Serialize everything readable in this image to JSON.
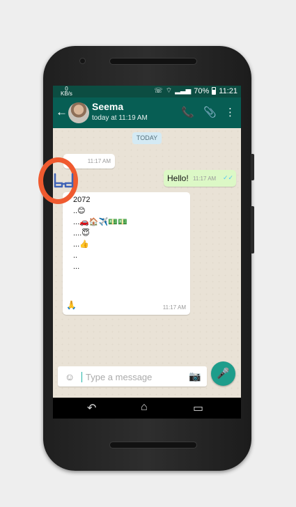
{
  "status_bar": {
    "speed": "0",
    "speed_unit": "KB/s",
    "battery": "70%",
    "time": "11:21"
  },
  "chat_header": {
    "name": "Seema",
    "status": "today at 11:19 AM"
  },
  "date_chip": "TODAY",
  "messages": [
    {
      "direction": "in",
      "text": "",
      "time": "11:17 AM"
    },
    {
      "direction": "out",
      "text": "Hello!",
      "time": "11:17 AM"
    },
    {
      "direction": "in",
      "lines": [
        "2072",
        "..😊",
        "...🚗🏠✈️💵💵",
        "....😇",
        "...👍",
        "..",
        "..."
      ],
      "footer_emoji": "🙏",
      "time": "11:17 AM"
    }
  ],
  "composer": {
    "placeholder": "Type a message"
  },
  "icons": {
    "back": "back-arrow-icon",
    "call": "phone-icon",
    "attach": "paperclip-icon",
    "menu": "more-vert-icon",
    "emoji": "emoji-icon",
    "camera": "camera-icon",
    "mic": "mic-icon"
  }
}
